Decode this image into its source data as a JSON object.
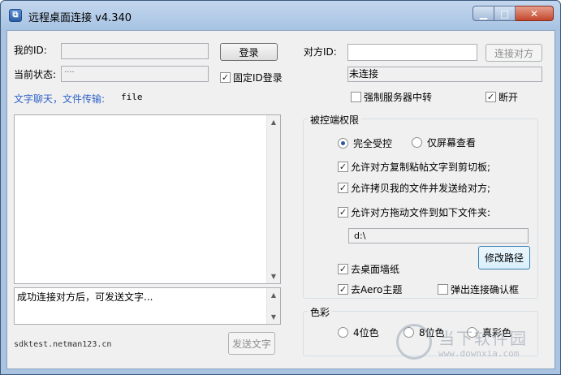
{
  "window": {
    "title": "远程桌面连接 v4.340",
    "app_icon": "remote-desktop-icon"
  },
  "left": {
    "my_id_label": "我的ID:",
    "my_id_value": "",
    "login_button": "登录",
    "status_label": "当前状态:",
    "status_value": "····",
    "fixed_id_login": {
      "label": "固定ID登录",
      "checked": true
    },
    "chat_label": "文字聊天，文件传输:",
    "file_label": "file",
    "chat_log": "",
    "message_input": "成功连接对方后，可发送文字...",
    "footer_text": "sdktest.netman123.cn",
    "send_button": "发送文字"
  },
  "right": {
    "peer_id_label": "对方ID:",
    "peer_id_value": "",
    "connect_button": "连接对方",
    "connection_status": "未连接",
    "force_relay": {
      "label": "强制服务器中转",
      "checked": false
    },
    "disconnect": {
      "label": "断开",
      "checked": true
    },
    "permissions_group": "被控端权限",
    "full_control": {
      "label": "完全受控",
      "selected": true
    },
    "view_only": {
      "label": "仅屏幕查看",
      "selected": false
    },
    "allow_clipboard": {
      "label": "允许对方复制粘帖文字到剪切板;",
      "checked": true
    },
    "allow_copy_files": {
      "label": "允许拷贝我的文件并发送给对方;",
      "checked": true
    },
    "allow_drag_files": {
      "label": "允许对方拖动文件到如下文件夹:",
      "checked": true
    },
    "folder_path": "d:\\",
    "change_path_button": "修改路径",
    "remove_wallpaper": {
      "label": "去桌面墙纸",
      "checked": true
    },
    "remove_aero": {
      "label": "去Aero主题",
      "checked": true
    },
    "popup_confirm": {
      "label": "弹出连接确认框",
      "checked": false
    },
    "color_group": "色彩",
    "color_options": [
      {
        "label": "4位色",
        "selected": false
      },
      {
        "label": "8位色",
        "selected": false
      },
      {
        "label": "真彩色",
        "selected": false
      }
    ]
  },
  "watermark": {
    "text": "当下软件园",
    "url": "www.downxia.com"
  },
  "colors": {
    "accent_blue": "#3164c7",
    "window_frame": "#a9c3e0",
    "client_bg": "#f0f0f0"
  }
}
